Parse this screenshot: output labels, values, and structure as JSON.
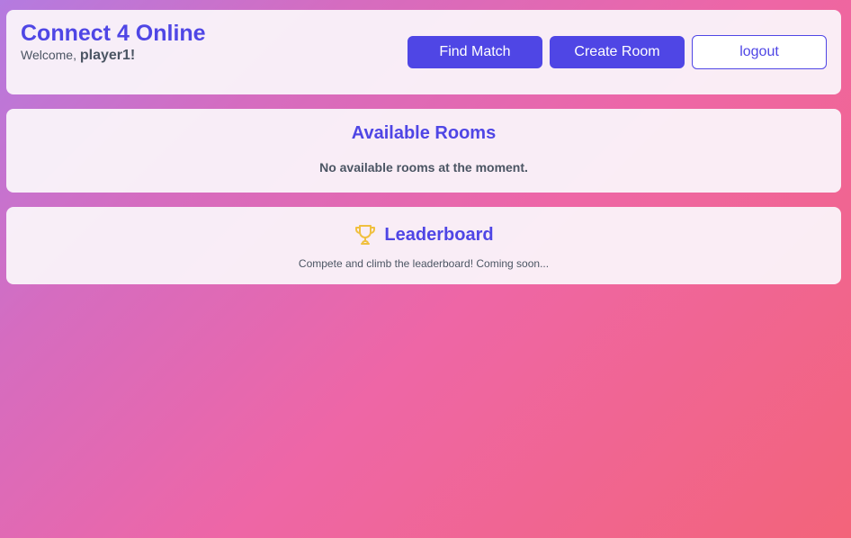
{
  "header": {
    "title": "Connect 4 Online",
    "welcome_prefix": "Welcome,",
    "username": "player1!",
    "buttons": {
      "find_match": "Find Match",
      "create_room": "Create Room",
      "logout": "logout"
    }
  },
  "rooms": {
    "title": "Available Rooms",
    "empty_message": "No available rooms at the moment."
  },
  "leaderboard": {
    "icon": "trophy-icon",
    "title": "Leaderboard",
    "message": "Compete and climb the leaderboard! Coming soon..."
  },
  "colors": {
    "accent": "#4f46e5",
    "trophy": "#f0c040",
    "text_muted": "#4b5563"
  }
}
